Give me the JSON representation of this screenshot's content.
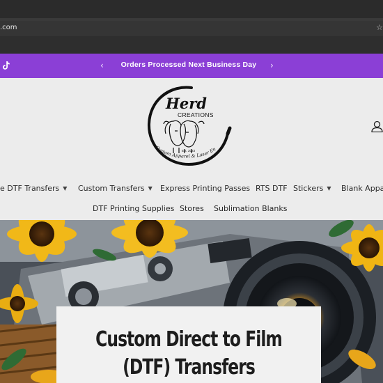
{
  "browser": {
    "url_fragment": ".com",
    "bookmark_icon": "star-icon"
  },
  "announcement": {
    "message": "Orders Processed Next Business Day",
    "prev_icon": "chevron-left-icon",
    "next_icon": "chevron-right-icon",
    "social_icon": "tiktok-icon",
    "background": "#8b3fd6"
  },
  "logo": {
    "line1": "Herd",
    "line2": "CREATIONS",
    "est": "Est. 2023",
    "tagline": "Custom Apparel & Laser Engraving"
  },
  "header": {
    "account_icon": "user-icon"
  },
  "nav": {
    "row1": [
      {
        "label": "gle DTF Transfers",
        "has_dropdown": true
      },
      {
        "label": "Custom Transfers",
        "has_dropdown": true
      },
      {
        "label": "Express Printing Passes",
        "has_dropdown": false
      },
      {
        "label": "RTS DTF",
        "has_dropdown": false
      },
      {
        "label": "Stickers",
        "has_dropdown": true
      },
      {
        "label": "Blank Appar",
        "has_dropdown": false
      }
    ],
    "row2": [
      {
        "label": "DTF Printing Supplies"
      },
      {
        "label": "Stores"
      },
      {
        "label": "Sublimation Blanks"
      }
    ]
  },
  "hero": {
    "title": "Custom Direct to Film (DTF) Transfers",
    "title_line1": "Custom Direct to Film",
    "title_line2": "(DTF) Transfers"
  }
}
